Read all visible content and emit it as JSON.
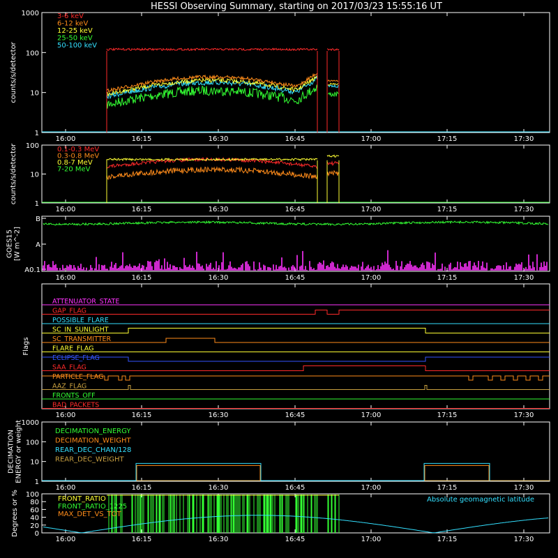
{
  "title": "HESSI Observing Summary, starting on 2017/03/23 15:55:16 UT",
  "time_ticks": [
    "16:00",
    "16:15",
    "16:30",
    "16:45",
    "17:00",
    "17:15",
    "17:30"
  ],
  "colors": {
    "red": "#ff2a2a",
    "orange": "#ff8c1a",
    "yellow": "#ffff33",
    "green": "#33ff33",
    "cyan": "#33e0ff",
    "magenta": "#ff33ff",
    "blue": "#3355ff",
    "olive": "#c8a040",
    "axis": "#ffffff"
  },
  "chart_data": [
    {
      "id": "lo",
      "type": "line",
      "ylabel": "counts/s/detector",
      "yscale": "log",
      "ylim": [
        1,
        1000
      ],
      "yticks": [
        "1",
        "10",
        "100",
        "1000"
      ],
      "series": [
        {
          "name": "3-6 keV",
          "color": "red",
          "level": 120
        },
        {
          "name": "6-12 keV",
          "color": "orange",
          "level": 12
        },
        {
          "name": "12-25 keV",
          "color": "yellow",
          "level": 9
        },
        {
          "name": "25-50 keV",
          "color": "green",
          "level": 6
        },
        {
          "name": "50-100 keV",
          "color": "cyan",
          "level": 8
        }
      ]
    },
    {
      "id": "hi",
      "type": "line",
      "ylabel": "counts/s/detector",
      "yscale": "log",
      "ylim": [
        1,
        100
      ],
      "yticks": [
        "1",
        "10",
        "100"
      ],
      "series": [
        {
          "name": "0.1-0.3 MeV",
          "color": "red",
          "level": 20
        },
        {
          "name": "0.3-0.8 MeV",
          "color": "orange",
          "level": 12
        },
        {
          "name": "0.8-7 MeV",
          "color": "yellow",
          "level": 32
        },
        {
          "name": "7-20 MeV",
          "color": "green",
          "level": 1
        }
      ]
    },
    {
      "id": "goes",
      "type": "line",
      "ylabel": "GOES15\n[W m^-2]",
      "yticks": [
        "A0.1",
        "A",
        "B"
      ],
      "series": []
    },
    {
      "id": "flags",
      "type": "line",
      "ylabel": "Flags",
      "series": [
        {
          "name": "ATTENUATOR_STATE",
          "color": "magenta"
        },
        {
          "name": "GAP_FLAG",
          "color": "red"
        },
        {
          "name": "POSSIBLE_FLARE",
          "color": "cyan"
        },
        {
          "name": "SC_IN_SUNLIGHT",
          "color": "yellow"
        },
        {
          "name": "SC_TRANSMITTER",
          "color": "orange"
        },
        {
          "name": "FLARE_FLAG",
          "color": "yellow"
        },
        {
          "name": "ECLIPSE_FLAG",
          "color": "blue"
        },
        {
          "name": "SAA_FLAG",
          "color": "red"
        },
        {
          "name": "PARTICLE_FLAG",
          "color": "orange"
        },
        {
          "name": "AAZ_FLAG",
          "color": "olive"
        },
        {
          "name": "FRONTS_OFF",
          "color": "green"
        },
        {
          "name": "BAD_PACKETS",
          "color": "red"
        }
      ]
    },
    {
      "id": "dec",
      "type": "line",
      "ylabel": "DECIMATION\nENERGY or weight",
      "yscale": "log",
      "ylim": [
        1,
        1000
      ],
      "yticks": [
        "1",
        "10",
        "100",
        "1000"
      ],
      "series": [
        {
          "name": "DECIMATION_ENERGY",
          "color": "green"
        },
        {
          "name": "DECIMATION_WEIGHT",
          "color": "orange"
        },
        {
          "name": "REAR_DEC_CHAN/128",
          "color": "cyan"
        },
        {
          "name": "REAR_DEC_WEIGHT",
          "color": "olive"
        }
      ]
    },
    {
      "id": "ratio",
      "type": "line",
      "ylabel": "Degrees or %",
      "ylim": [
        0,
        100
      ],
      "yticks": [
        "0",
        "20",
        "40",
        "60",
        "80",
        "100"
      ],
      "annotation": "Absolute geomagnetic latitude",
      "series": [
        {
          "name": "FRONT_RATIO",
          "color": "yellow"
        },
        {
          "name": "FRONT_RATIO_1225",
          "color": "green"
        },
        {
          "name": "MAX_DET_VS_TOT",
          "color": "orange"
        }
      ]
    }
  ]
}
